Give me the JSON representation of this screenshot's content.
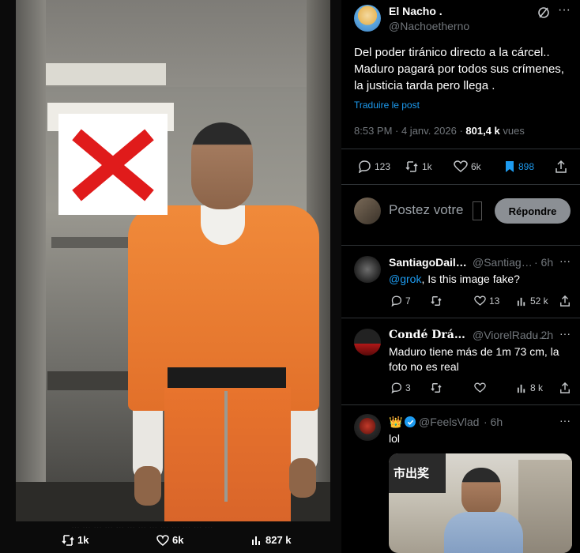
{
  "left_post": {
    "reply_count": "",
    "repost_count": "1k",
    "like_count": "6k",
    "view_count": "827 k",
    "faded_caption": "… … … … … … … … … … … … …"
  },
  "main_tweet": {
    "display_name": "El Nacho .",
    "handle": "@Nachoetherno",
    "body": "Del poder tiránico directo a la cárcel.. Maduro pagará por todos sus crímenes, la justicia tarda pero llega .",
    "translate_label": "Traduire le post",
    "timestamp": "8:53 PM · 4 janv. 2026 · ",
    "views_value": "801,4 k",
    "views_label": " vues",
    "reply_count": "123",
    "repost_count": "1k",
    "like_count": "6k",
    "bookmark_count": "898"
  },
  "composer": {
    "placeholder": "Postez votre",
    "reply_button": "Répondre"
  },
  "replies": [
    {
      "display_name": "SantiagoDail…",
      "handle": "@Santiag…",
      "time": "· 6h",
      "mention": "@grok",
      "body": ", Is this image fake?",
      "reply_count": "7",
      "repost_count": "",
      "like_count": "13",
      "view_count": "52 k"
    },
    {
      "display_name": "Condé Drá…",
      "handle": "@ViorelRadu…",
      "time": "· 2h",
      "mention": "",
      "body": "Maduro tiene más de 1m 73 cm, la foto no es real",
      "reply_count": "3",
      "repost_count": "",
      "like_count": "",
      "view_count": "8 k"
    },
    {
      "display_name": "",
      "handle": "@FeelsVlad",
      "time": "· 6h",
      "mention": "",
      "body": "lol",
      "image_sign": "市出奖"
    }
  ],
  "colors": {
    "accent": "#1d9bf0",
    "muted": "#71767b",
    "x_mark": "#e01b1b",
    "jumpsuit": "#e8742d"
  }
}
